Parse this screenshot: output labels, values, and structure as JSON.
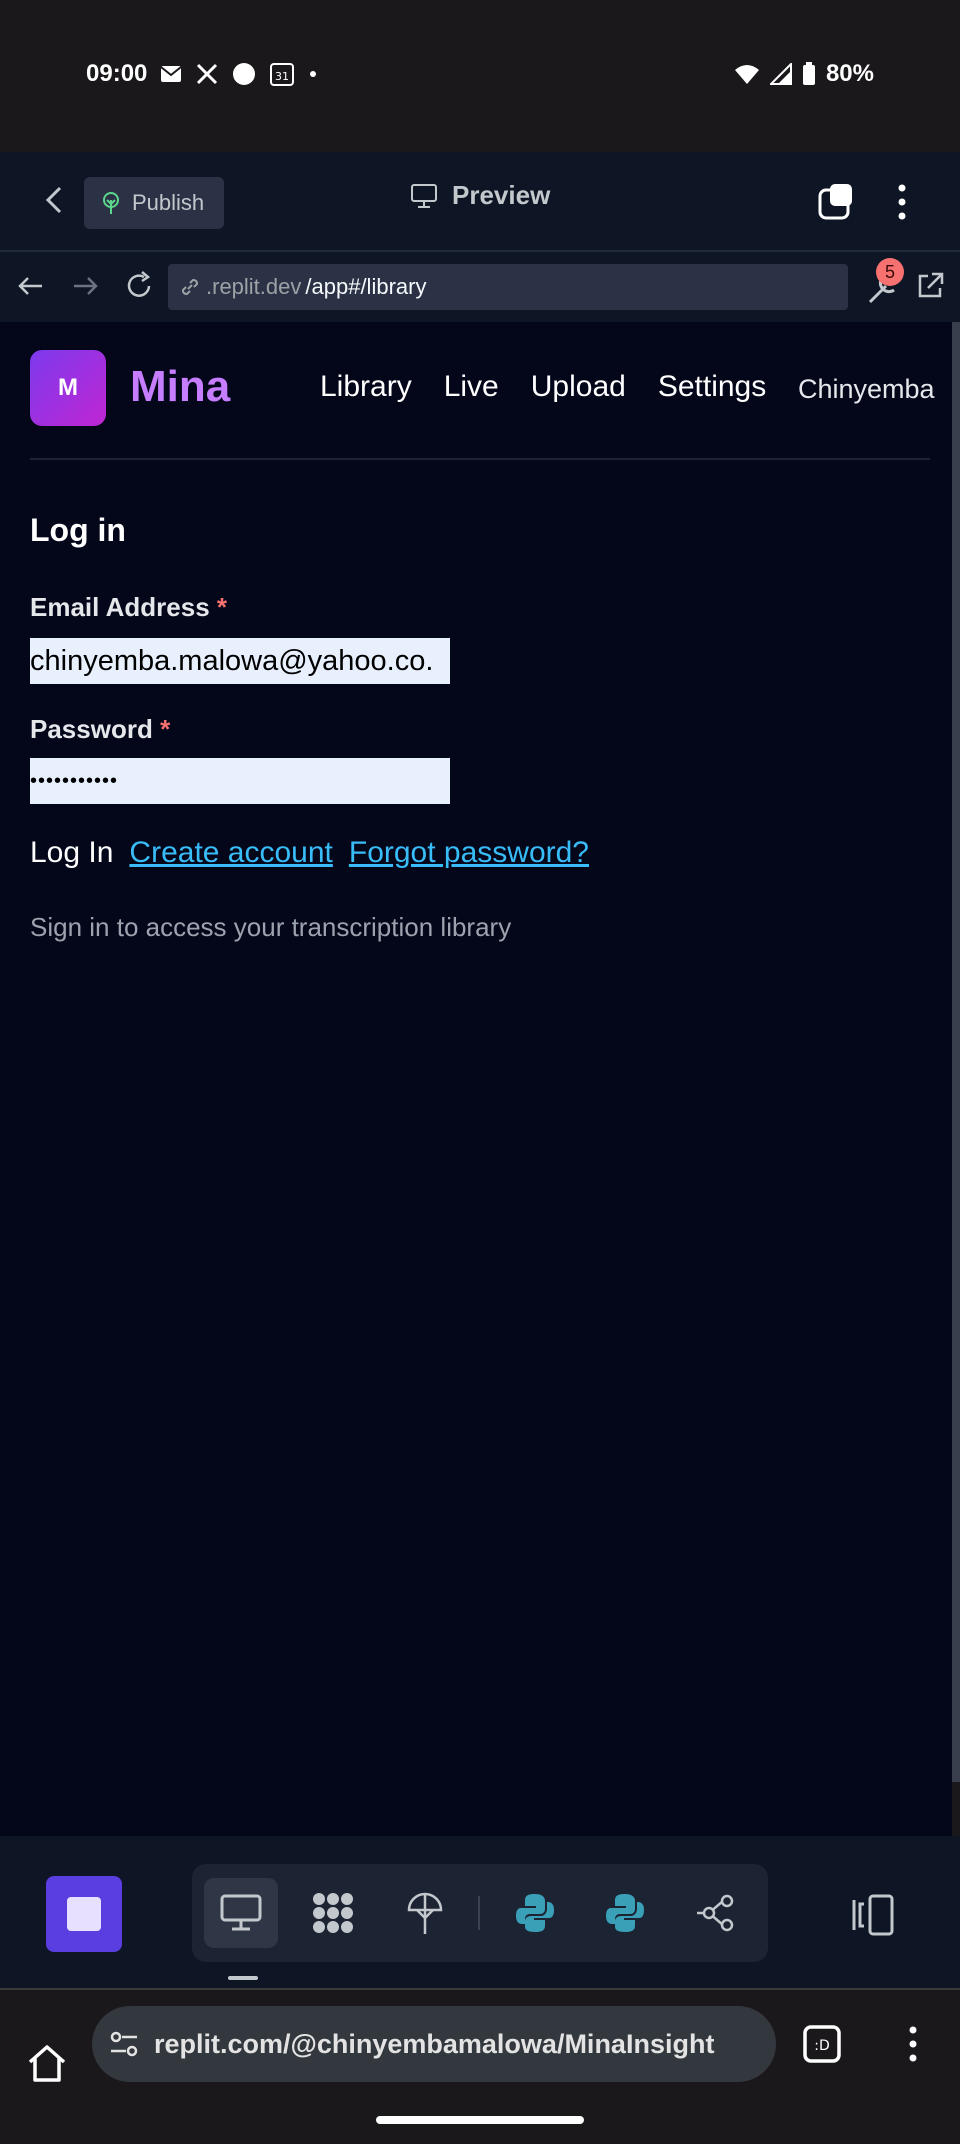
{
  "status_bar": {
    "time": "09:00",
    "battery": "80%",
    "calendar_date": "31"
  },
  "replit_header": {
    "publish_label": "Publish",
    "preview_label": "Preview"
  },
  "browser": {
    "url_domain": ".replit.dev",
    "url_path": "/app#/library",
    "badge_count": "5"
  },
  "app": {
    "logo_letter": "M",
    "brand": "Mina",
    "nav": [
      "Library",
      "Live",
      "Upload",
      "Settings"
    ],
    "user_name": "Chinyemba",
    "login": {
      "title": "Log in",
      "email_label": "Email Address",
      "email_value": "chinyemba.malowa@yahoo.co.",
      "password_label": "Password",
      "password_value": "•••••••••••",
      "required_mark": "*",
      "login_button": "Log In",
      "create_account": "Create account",
      "forgot_password": "Forgot password?",
      "hint": "Sign in to access your transcription library"
    }
  },
  "chrome": {
    "omnibox_url": "replit.com/@chinyembamalowa/MinaInsight"
  },
  "colors": {
    "app_bg": "#04061a",
    "brand": "#c77dff",
    "link": "#38bdf8",
    "required": "#f87171",
    "replit_bg": "#0e1525"
  }
}
